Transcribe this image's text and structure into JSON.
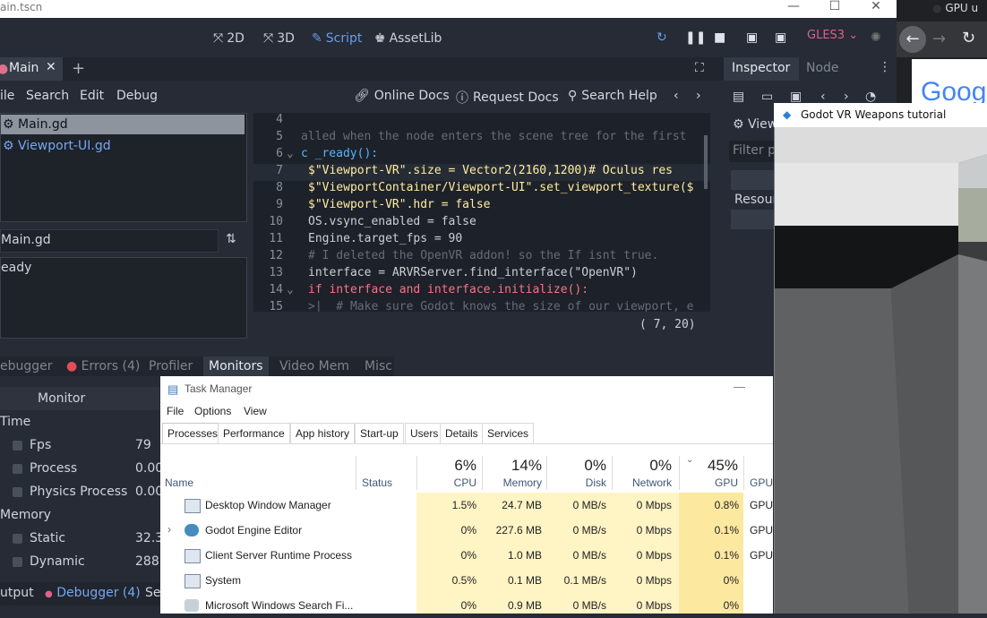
{
  "godot": {
    "title": "ain.tscn",
    "workspaces": [
      {
        "label": "2D",
        "active": false
      },
      {
        "label": "3D",
        "active": false
      },
      {
        "label": "Script",
        "active": true
      },
      {
        "label": "AssetLib",
        "active": false
      }
    ],
    "renderer": "GLES3",
    "scene_tab": "Main",
    "menus": [
      "ile",
      "Search",
      "Edit",
      "Debug"
    ],
    "tools": [
      "Online Docs",
      "Request Docs",
      "Search Help"
    ],
    "scripts": [
      "Main.gd",
      "Viewport-UI.gd"
    ],
    "filter_text": "Main.gd",
    "outline_text": "eady",
    "code_lines": [
      {
        "n": "4",
        "text": ""
      },
      {
        "n": "5",
        "text": "alled when the node enters the scene tree for the first"
      },
      {
        "n": "6",
        "text": "c _ready():"
      },
      {
        "n": "7",
        "text": "$\"Viewport-VR\".size = Vector2(2160,1200)# Oculus res"
      },
      {
        "n": "8",
        "text": "$\"ViewportContainer/Viewport-UI\".set_viewport_texture($"
      },
      {
        "n": "9",
        "text": "$\"Viewport-VR\".hdr = false"
      },
      {
        "n": "10",
        "text": "OS.vsync_enabled = false"
      },
      {
        "n": "11",
        "text": "Engine.target_fps = 90"
      },
      {
        "n": "12",
        "text": "# I deleted the OpenVR addon! so the If isnt true."
      },
      {
        "n": "13",
        "text": "interface = ARVRServer.find_interface(\"OpenVR\")"
      },
      {
        "n": "14",
        "text": "if interface and interface.initialize():"
      },
      {
        "n": "15",
        "text": ">|  # Make sure Godot knows the size of our viewport, e"
      }
    ],
    "caret_pos": "(   7, 20)",
    "inspector_tabs": [
      "Inspector",
      "Node"
    ],
    "inspector_items": [
      "View",
      "Filter p",
      "Resour"
    ],
    "bottom_tabs": [
      "ebugger",
      "Errors (4)",
      "Profiler",
      "Monitors",
      "Video Mem",
      "Misc"
    ],
    "monitor_header": "Monitor",
    "monitor_rows": [
      {
        "label": "Time",
        "group": true,
        "value": ""
      },
      {
        "label": "Fps",
        "group": false,
        "value": "79"
      },
      {
        "label": "Process",
        "group": false,
        "value": "0.00"
      },
      {
        "label": "Physics Process",
        "group": false,
        "value": "0.00"
      },
      {
        "label": "Memory",
        "group": true,
        "value": ""
      },
      {
        "label": "Static",
        "group": false,
        "value": "32.3"
      },
      {
        "label": "Dynamic",
        "group": false,
        "value": "288"
      }
    ],
    "bottom_bar": [
      "utput",
      "Debugger (4)",
      "Se"
    ]
  },
  "chrome": {
    "tab_title": "GPU u",
    "logo_text": "Goog"
  },
  "game_window": {
    "title": "Godot VR Weapons tutorial"
  },
  "task_manager": {
    "title": "Task Manager",
    "menu": [
      "File",
      "Options",
      "View"
    ],
    "tabs": [
      "Processes",
      "Performance",
      "App history",
      "Start-up",
      "Users",
      "Details",
      "Services"
    ],
    "columns": [
      {
        "label": "Name",
        "pct": ""
      },
      {
        "label": "Status",
        "pct": ""
      },
      {
        "label": "CPU",
        "pct": "6%"
      },
      {
        "label": "Memory",
        "pct": "14%"
      },
      {
        "label": "Disk",
        "pct": "0%"
      },
      {
        "label": "Network",
        "pct": "0%"
      },
      {
        "label": "GPU",
        "pct": "45%"
      },
      {
        "label": "GPU",
        "pct": ""
      }
    ],
    "rows": [
      {
        "name": "Desktop Window Manager",
        "cpu": "1.5%",
        "mem": "24.7 MB",
        "disk": "0 MB/s",
        "net": "0 Mbps",
        "gpu": "0.8%",
        "gpue": "GPU"
      },
      {
        "name": "Godot Engine Editor",
        "cpu": "0%",
        "mem": "227.6 MB",
        "disk": "0 MB/s",
        "net": "0 Mbps",
        "gpu": "0.1%",
        "gpue": "GPU"
      },
      {
        "name": "Client Server Runtime Process",
        "cpu": "0%",
        "mem": "1.0 MB",
        "disk": "0 MB/s",
        "net": "0 Mbps",
        "gpu": "0.1%",
        "gpue": "GPU"
      },
      {
        "name": "System",
        "cpu": "0.5%",
        "mem": "0.1 MB",
        "disk": "0.1 MB/s",
        "net": "0 Mbps",
        "gpu": "0%",
        "gpue": ""
      },
      {
        "name": "Microsoft Windows Search Fi...",
        "cpu": "0%",
        "mem": "0.9 MB",
        "disk": "0 MB/s",
        "net": "0 Mbps",
        "gpu": "0%",
        "gpue": ""
      }
    ]
  }
}
